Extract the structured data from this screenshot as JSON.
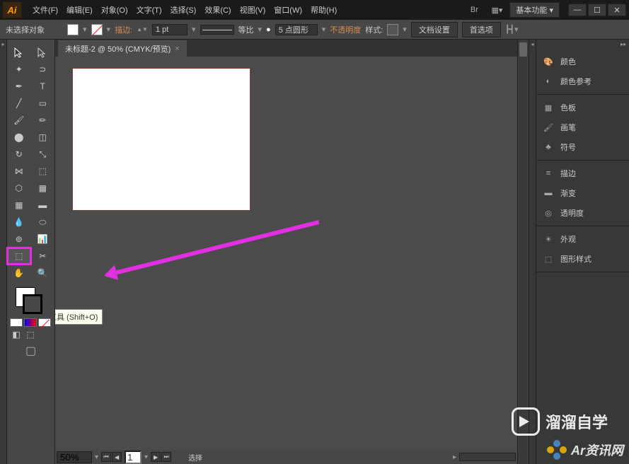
{
  "app": {
    "logo": "Ai"
  },
  "menu": {
    "items": [
      "文件(F)",
      "编辑(E)",
      "对象(O)",
      "文字(T)",
      "选择(S)",
      "效果(C)",
      "视图(V)",
      "窗口(W)",
      "帮助(H)"
    ]
  },
  "workspace": {
    "label": "基本功能"
  },
  "controlbar": {
    "no_selection": "未选择对象",
    "stroke_label": "描边:",
    "stroke_value": "1 pt",
    "uniform": "等比",
    "brush_value": "5 点圆形",
    "opacity_label": "不透明度",
    "style_label": "样式:",
    "doc_setup": "文档设置",
    "preferences": "首选项"
  },
  "tab": {
    "title": "未标题-2 @ 50% (CMYK/预览)",
    "close": "×"
  },
  "tooltip": "画板工具 (Shift+O)",
  "status": {
    "zoom": "50%",
    "page": "1",
    "info": "选择"
  },
  "panels": {
    "group1": [
      "颜色",
      "颜色参考"
    ],
    "group2": [
      "色板",
      "画笔",
      "符号"
    ],
    "group3": [
      "描边",
      "渐变",
      "透明度"
    ],
    "group4": [
      "外观",
      "图形样式"
    ]
  },
  "watermark1": "溜溜自学",
  "watermark2": "Ar资讯网"
}
